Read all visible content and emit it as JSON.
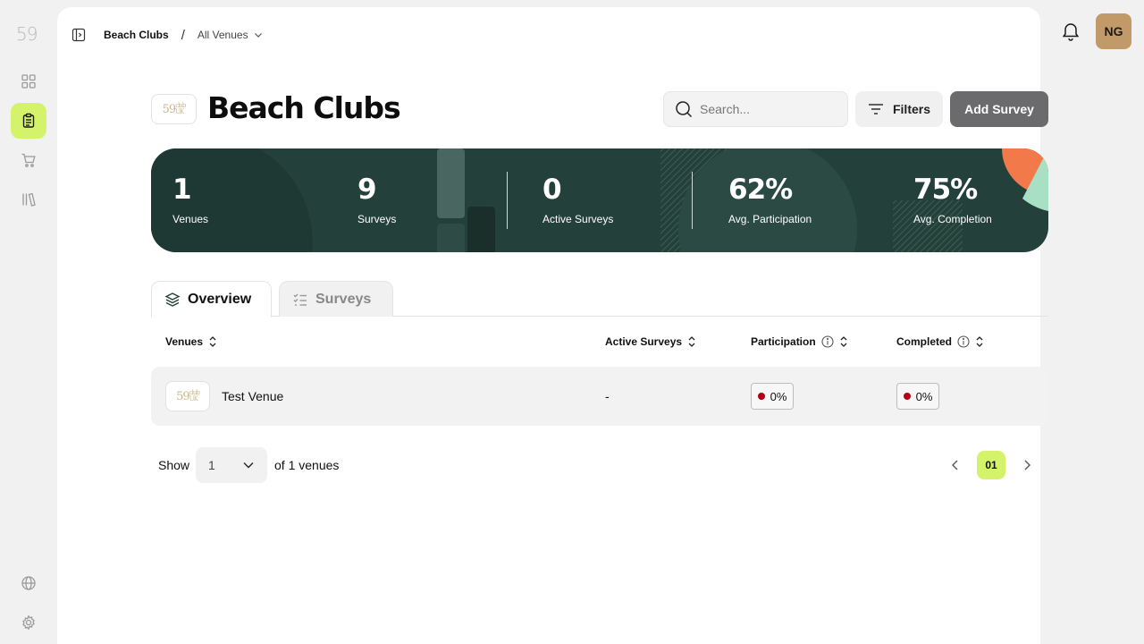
{
  "sidebar": {
    "logo": "59",
    "items": [
      {
        "name": "dashboard",
        "icon": "grid-icon"
      },
      {
        "name": "surveys",
        "icon": "clipboard-icon",
        "active": true
      },
      {
        "name": "shop",
        "icon": "cart-icon"
      },
      {
        "name": "library",
        "icon": "library-icon"
      }
    ],
    "bottom_items": [
      {
        "name": "language",
        "icon": "globe-icon"
      },
      {
        "name": "settings",
        "icon": "gear-icon"
      }
    ]
  },
  "breadcrumb": {
    "current": "Beach Clubs",
    "separator": "/",
    "dropdown": "All Venues"
  },
  "user": {
    "initials": "NG",
    "avatar_color": "#c29a6a"
  },
  "header": {
    "title": "Beach Clubs",
    "logo_text": "59",
    "logo_small_top": "club",
    "logo_small_bottom": "UK",
    "search_placeholder": "Search...",
    "filters_label": "Filters",
    "add_label": "Add Survey"
  },
  "stats": [
    {
      "value": "1",
      "label": "Venues"
    },
    {
      "value": "9",
      "label": "Surveys"
    },
    {
      "value": "0",
      "label": "Active Surveys"
    },
    {
      "value": "62%",
      "label": "Avg. Participation"
    },
    {
      "value": "75%",
      "label": "Avg. Completion"
    }
  ],
  "tabs": [
    {
      "label": "Overview",
      "active": true
    },
    {
      "label": "Surveys",
      "active": false
    }
  ],
  "table": {
    "columns": [
      "Venues",
      "Active Surveys",
      "Participation",
      "Completed"
    ],
    "rows": [
      {
        "venue": "Test Venue",
        "active_surveys": "-",
        "participation": "0%",
        "completed": "0%"
      }
    ]
  },
  "footer": {
    "show_label": "Show",
    "page_size": "1",
    "of_label": "of 1 venues",
    "current_page": "01"
  },
  "colors": {
    "accent": "#d4f26a",
    "banner": "#24403b",
    "status_dot": "#b00015",
    "add_button": "#6b6b6e"
  }
}
